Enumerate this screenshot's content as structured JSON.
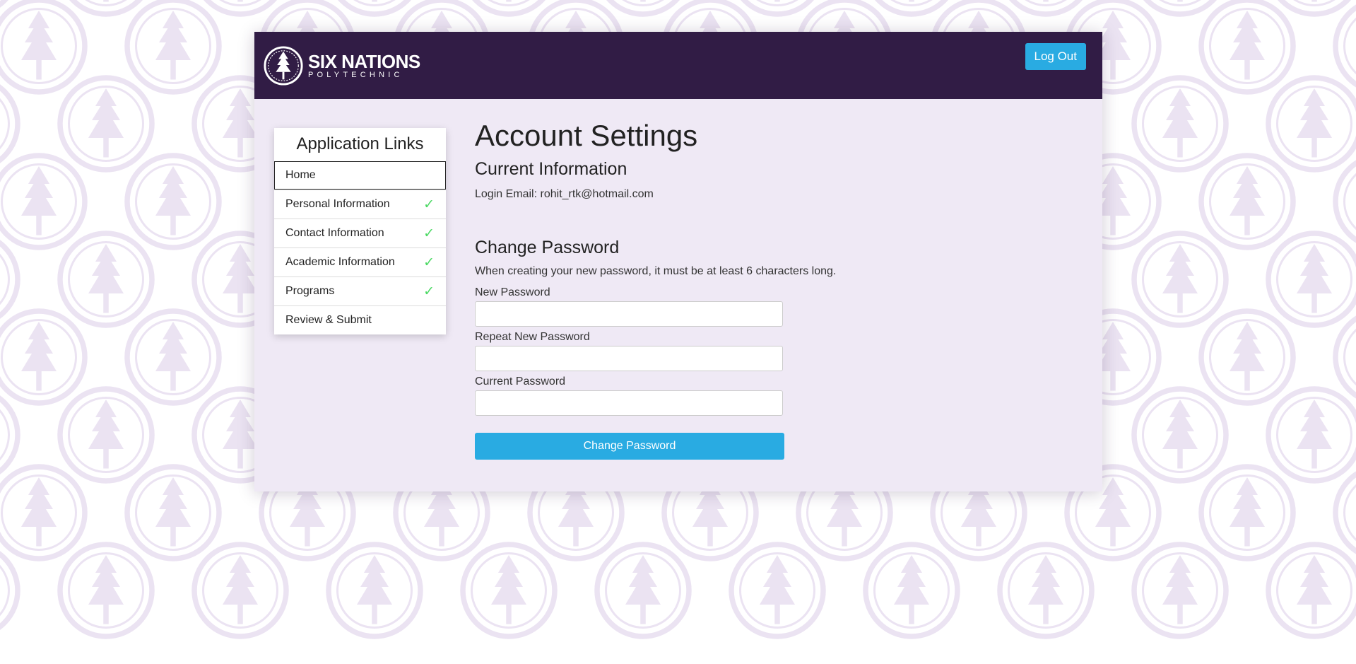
{
  "brand": {
    "name": "SIX NATIONS",
    "subtitle": "POLYTECHNIC",
    "logo_icon": "tree-emblem-icon"
  },
  "header": {
    "logout_label": "Log Out"
  },
  "sidebar": {
    "title": "Application Links",
    "items": [
      {
        "label": "Home",
        "completed": false,
        "active": true
      },
      {
        "label": "Personal Information",
        "completed": true,
        "active": false
      },
      {
        "label": "Contact Information",
        "completed": true,
        "active": false
      },
      {
        "label": "Academic Information",
        "completed": true,
        "active": false
      },
      {
        "label": "Programs",
        "completed": true,
        "active": false
      },
      {
        "label": "Review & Submit",
        "completed": false,
        "active": false
      }
    ],
    "check_icon": "check-icon",
    "check_glyph": "✓"
  },
  "main": {
    "title": "Account Settings",
    "current_info": {
      "heading": "Current Information",
      "login_email_label": "Login Email:",
      "login_email": "rohit_rtk@hotmail.com"
    },
    "change_password": {
      "heading": "Change Password",
      "help_text": "When creating your new password, it must be at least 6 characters long.",
      "new_password_label": "New Password",
      "new_password_value": "",
      "repeat_password_label": "Repeat New Password",
      "repeat_password_value": "",
      "current_password_label": "Current Password",
      "current_password_value": "",
      "submit_label": "Change Password"
    }
  },
  "colors": {
    "header_bg": "#311c45",
    "panel_bg": "#efe9f5",
    "accent": "#29abe2",
    "check": "#4cd964",
    "pattern": "#ebe3f2"
  }
}
